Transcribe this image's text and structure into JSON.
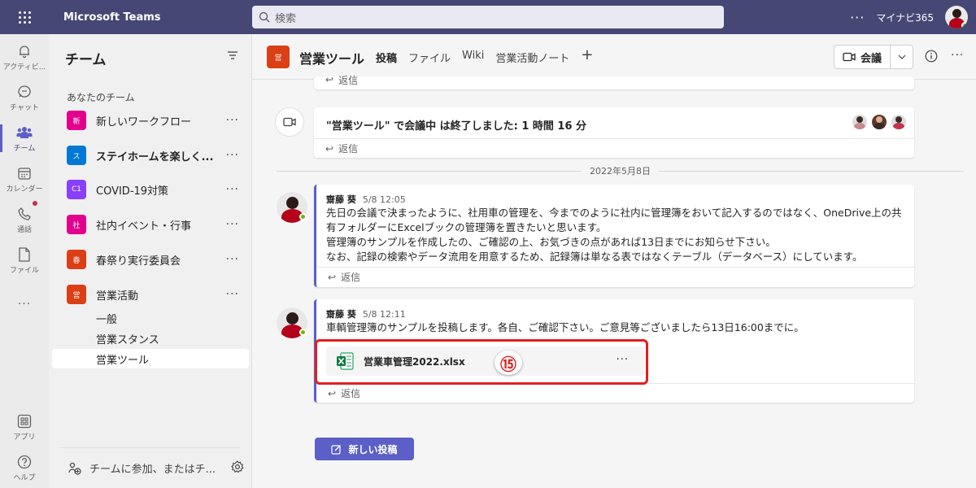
{
  "app": {
    "title": "Microsoft Teams",
    "user": "マイナビ365"
  },
  "search": {
    "placeholder": "検索"
  },
  "rail": [
    {
      "label": "アクティビ..."
    },
    {
      "label": "チャット"
    },
    {
      "label": "チーム"
    },
    {
      "label": "カレンダー"
    },
    {
      "label": "通話"
    },
    {
      "label": "ファイル"
    },
    {
      "label": "..."
    },
    {
      "label": "アプリ"
    },
    {
      "label": "ヘルプ"
    }
  ],
  "sidebar": {
    "title": "チーム",
    "section": "あなたのチーム",
    "teams": [
      {
        "tile": "新",
        "name": "新しいワークフロー",
        "color": "#e3008c"
      },
      {
        "tile": "ス",
        "name": "ステイホームを楽しく...",
        "color": "#0078d4"
      },
      {
        "tile": "C1",
        "name": "COVID-19対策",
        "color": "#8a3ffc"
      },
      {
        "tile": "社",
        "name": "社内イベント・行事",
        "color": "#e3008c"
      },
      {
        "tile": "春",
        "name": "春祭り実行委員会",
        "color": "#dc3e15"
      },
      {
        "tile": "営",
        "name": "営業活動",
        "color": "#dc3e15"
      }
    ],
    "channels": [
      "一般",
      "営業スタンス",
      "営業ツール"
    ],
    "join": "チームに参加、またはチ..."
  },
  "header": {
    "tile": "営",
    "channel": "営業ツール",
    "tabs": [
      "投稿",
      "ファイル",
      "Wiki",
      "営業活動ノート"
    ],
    "tab_add": "+",
    "meet": "会議"
  },
  "messages": {
    "reply": "返信",
    "meeting_end": "\"営業ツール\" で会議中 は終了しました: 1 時間 16 分",
    "date_divider": "2022年5月8日",
    "post1": {
      "author": "齋藤 葵",
      "time": "5/8 12:05",
      "line1": "先日の会議で決まったように、社用車の管理を、今までのように社内に管理簿をおいて記入するのではなく、OneDrive上の共",
      "line2": "有フォルダーにExcelブックの管理簿を置きたいと思います。",
      "line3": "管理簿のサンプルを作成したの、ご確認の上、お気づきの点があれば13日までにお知らせ下さい。",
      "line4": "なお、記録の検索やデータ流用を用意するため、記録簿は単なる表ではなくテーブル（データベース）にしています。"
    },
    "post2": {
      "author": "齋藤 葵",
      "time": "5/8 12:11",
      "text": "車輌管理簿のサンプルを投稿します。各自、ご確認下さい。ご意見等ございましたら13日16:00までに。",
      "file": "営業車管理2022.xlsx"
    },
    "badge": "⑮",
    "new_post": "新しい投稿"
  },
  "colors": {
    "accent": "#5b5fc7",
    "topbar": "#464775",
    "highlight": "#e02020"
  }
}
